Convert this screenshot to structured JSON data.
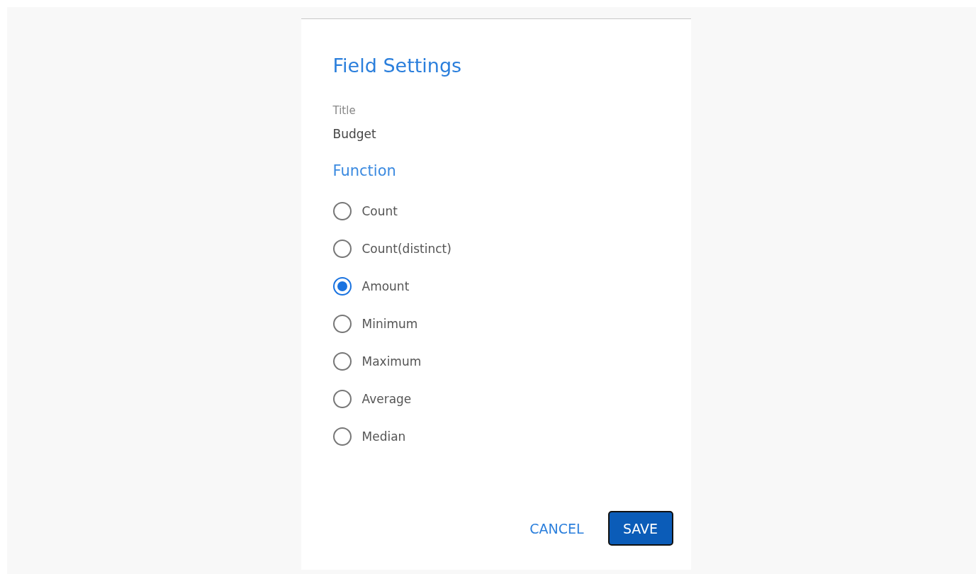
{
  "dialog": {
    "title": "Field Settings",
    "title_field": {
      "label": "Title",
      "value": "Budget"
    },
    "section": "Function",
    "options": [
      {
        "label": "Count",
        "selected": false
      },
      {
        "label": "Count(distinct)",
        "selected": false
      },
      {
        "label": "Amount",
        "selected": true
      },
      {
        "label": "Minimum",
        "selected": false
      },
      {
        "label": "Maximum",
        "selected": false
      },
      {
        "label": "Average",
        "selected": false
      },
      {
        "label": "Median",
        "selected": false
      }
    ],
    "buttons": [
      {
        "label": "CANCEL",
        "kind": "text"
      },
      {
        "label": "SAVE",
        "kind": "primary"
      }
    ]
  }
}
